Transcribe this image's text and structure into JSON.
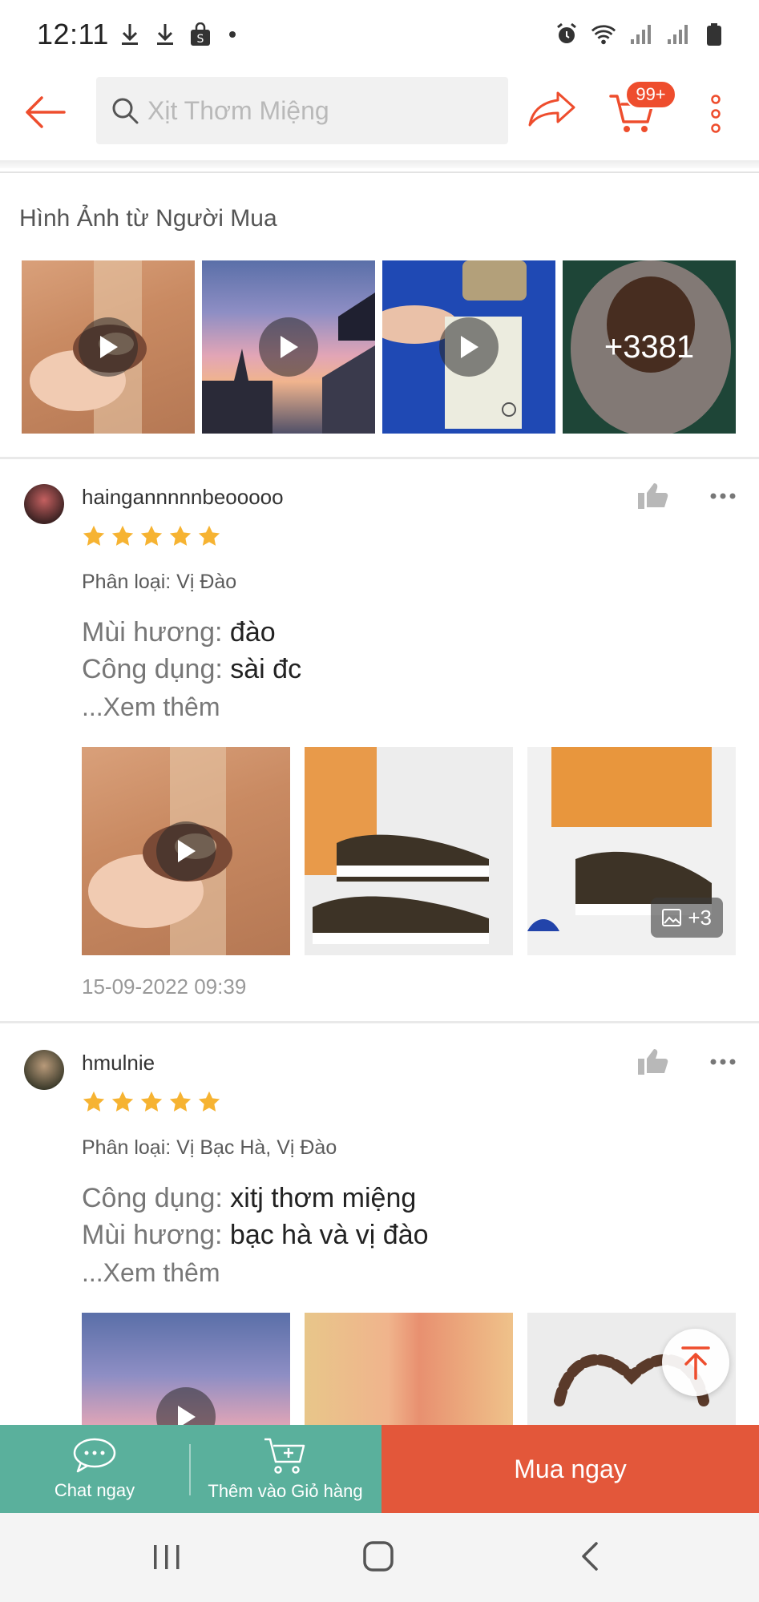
{
  "status_bar": {
    "time": "12:11"
  },
  "search": {
    "placeholder": "Xịt Thơm Miệng"
  },
  "cart": {
    "badge": "99+"
  },
  "buyer_photos": {
    "title": "Hình Ảnh từ Người Mua",
    "more_count": "+3381"
  },
  "reviews": [
    {
      "username": "haingannnnnbeooooo",
      "rating": 5,
      "variant": "Phân loại: Vị Đào",
      "lines": [
        {
          "label": "Mùi hương:",
          "value": "đào"
        },
        {
          "label": "Công dụng:",
          "value": "sài đc"
        }
      ],
      "see_more": "...Xem thêm",
      "image_count": "+3",
      "date": "15-09-2022 09:39"
    },
    {
      "username": "hmulnie",
      "rating": 5,
      "variant": "Phân loại: Vị Bạc Hà, Vị Đào",
      "lines": [
        {
          "label": "Công dụng:",
          "value": "xitj thơm miệng"
        },
        {
          "label": "Mùi hương:",
          "value": "bạc hà và vị đào"
        }
      ],
      "see_more": "...Xem thêm"
    }
  ],
  "bottom_bar": {
    "chat_label": "Chat ngay",
    "add_cart_label": "Thêm vào Giỏ hàng",
    "buy_label": "Mua ngay"
  },
  "colors": {
    "brand": "#ee4d2d",
    "teal": "#5ab09c",
    "buy": "#e3573a",
    "star": "#f6b332"
  }
}
